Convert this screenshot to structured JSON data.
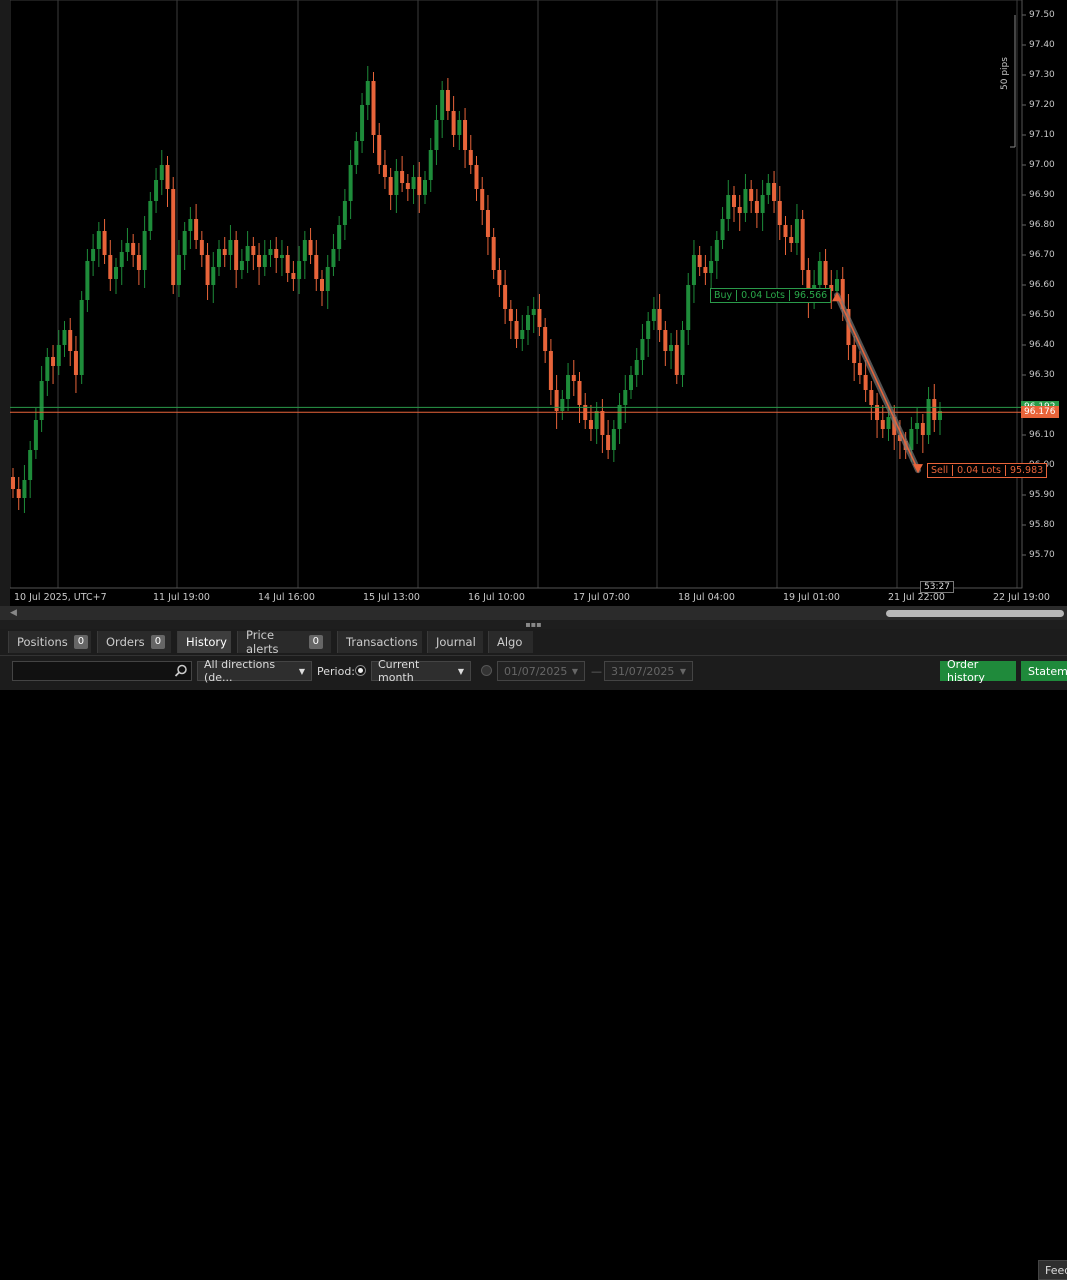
{
  "chart": {
    "y_axis_labels": [
      "97.50",
      "97.40",
      "97.30",
      "97.20",
      "97.10",
      "97.00",
      "96.90",
      "96.80",
      "96.70",
      "96.60",
      "96.50",
      "96.40",
      "96.30",
      "96.10",
      "96.00",
      "95.90",
      "95.80",
      "95.70"
    ],
    "x_axis_labels": [
      "10 Jul 2025, UTC+7",
      "11 Jul 19:00",
      "14 Jul 16:00",
      "15 Jul 13:00",
      "16 Jul 10:00",
      "17 Jul 07:00",
      "18 Jul 04:00",
      "19 Jul 01:00",
      "21 Jul 22:00",
      "22 Jul 19:00"
    ],
    "scale_label": "50 pips",
    "ask_price": "96.192",
    "bid_price": "96.176",
    "candle_timer": "53:27",
    "buy_trade": {
      "side": "Buy",
      "lots": "0.04 Lots",
      "price": "96.566"
    },
    "sell_trade": {
      "side": "Sell",
      "lots": "0.04 Lots",
      "price": "95.983"
    },
    "colors": {
      "bull": "#1e8c3a",
      "bear": "#e8643a",
      "ask_line": "#2a9a4a",
      "bid_line": "#e8643a"
    }
  },
  "chart_data": {
    "type": "candlestick",
    "ylim": [
      95.62,
      97.55
    ],
    "closes": [
      95.92,
      95.89,
      95.95,
      96.05,
      96.15,
      96.28,
      96.36,
      96.33,
      96.4,
      96.45,
      96.38,
      96.3,
      96.55,
      96.68,
      96.72,
      96.78,
      96.7,
      96.62,
      96.66,
      96.71,
      96.74,
      96.7,
      96.65,
      96.78,
      96.88,
      96.95,
      97.0,
      96.92,
      96.6,
      96.7,
      96.78,
      96.82,
      96.75,
      96.7,
      96.6,
      96.66,
      96.72,
      96.7,
      96.75,
      96.65,
      96.68,
      96.73,
      96.7,
      96.66,
      96.7,
      96.72,
      96.69,
      96.7,
      96.64,
      96.62,
      96.68,
      96.75,
      96.7,
      96.62,
      96.58,
      96.66,
      96.72,
      96.8,
      96.88,
      97.0,
      97.08,
      97.2,
      97.28,
      97.1,
      97.0,
      96.96,
      96.9,
      96.98,
      96.94,
      96.92,
      96.96,
      96.9,
      96.95,
      97.05,
      97.15,
      97.25,
      97.18,
      97.1,
      97.15,
      97.05,
      97.0,
      96.92,
      96.85,
      96.76,
      96.65,
      96.6,
      96.52,
      96.48,
      96.42,
      96.45,
      96.5,
      96.52,
      96.46,
      96.38,
      96.25,
      96.18,
      96.22,
      96.3,
      96.28,
      96.2,
      96.15,
      96.12,
      96.18,
      96.1,
      96.05,
      96.12,
      96.2,
      96.25,
      96.3,
      96.35,
      96.42,
      96.48,
      96.52,
      96.45,
      96.38,
      96.4,
      96.3,
      96.45,
      96.6,
      96.7,
      96.66,
      96.64,
      96.68,
      96.75,
      96.82,
      96.9,
      96.86,
      96.84,
      96.92,
      96.88,
      96.84,
      96.9,
      96.94,
      96.88,
      96.8,
      96.76,
      96.74,
      96.82,
      96.65,
      96.55,
      96.6,
      96.68,
      96.6,
      96.58,
      96.62,
      96.52,
      96.4,
      96.34,
      96.3,
      96.25,
      96.2,
      96.15,
      96.12,
      96.16,
      96.1,
      96.08,
      96.05,
      96.12,
      96.14,
      96.1,
      96.22,
      96.15,
      96.18
    ]
  },
  "tabs": [
    {
      "label": "Positions",
      "count": "0"
    },
    {
      "label": "Orders",
      "count": "0"
    },
    {
      "label": "History"
    },
    {
      "label": "Price alerts",
      "count": "0"
    },
    {
      "label": "Transactions"
    },
    {
      "label": "Journal"
    },
    {
      "label": "Algo"
    }
  ],
  "feed_label": "Feed",
  "filters": {
    "search_placeholder": "",
    "direction": "All directions (de...",
    "period_label": "Period:",
    "period_value": "Current month",
    "date_from": "01/07/2025",
    "date_to": "31/07/2025",
    "date_sep": "—",
    "order_history_button": "Order history",
    "statement_button": "Stateme"
  }
}
